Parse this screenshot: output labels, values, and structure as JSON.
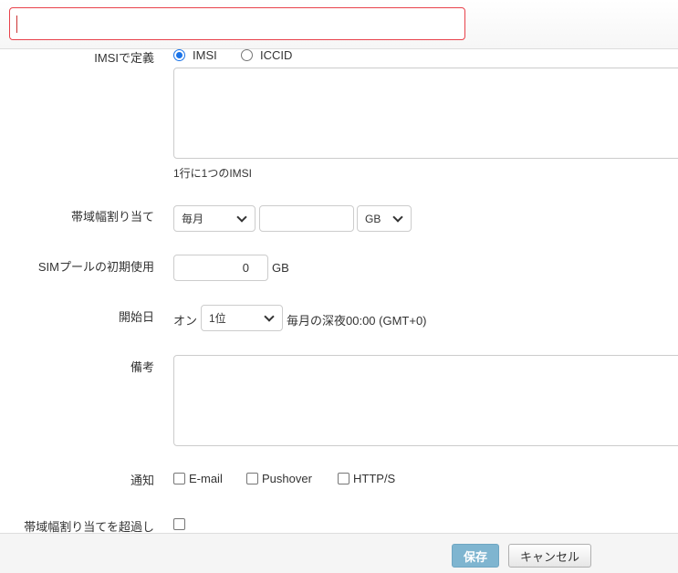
{
  "header": {
    "name_value": ""
  },
  "form": {
    "define_by": {
      "label": "IMSIで定義",
      "options": [
        "IMSI",
        "ICCID"
      ],
      "selected": "IMSI"
    },
    "imsi_list": {
      "value": "",
      "help": "1行に1つのIMSI"
    },
    "bandwidth": {
      "label": "帯域幅割り当て",
      "period": "毎月",
      "amount": "",
      "unit": "GB"
    },
    "initial_usage": {
      "label": "SIMプールの初期使用",
      "value": "0",
      "unit": "GB"
    },
    "start_date": {
      "label": "開始日",
      "prefix": "オン",
      "day": "1位",
      "suffix": "毎月の深夜00:00 (GMT+0)"
    },
    "notes": {
      "label": "備考",
      "value": ""
    },
    "notify": {
      "label": "通知",
      "options": [
        "E-mail",
        "Pushover",
        "HTTP/S"
      ]
    },
    "exceed": {
      "label": "帯域幅割り当てを超過し"
    }
  },
  "footer": {
    "save_label": "保存",
    "cancel_label": "キャンセル"
  },
  "colors": {
    "accent": "#1a73e8",
    "error_border": "#e8414a",
    "save_button": "#7fb5d0"
  }
}
